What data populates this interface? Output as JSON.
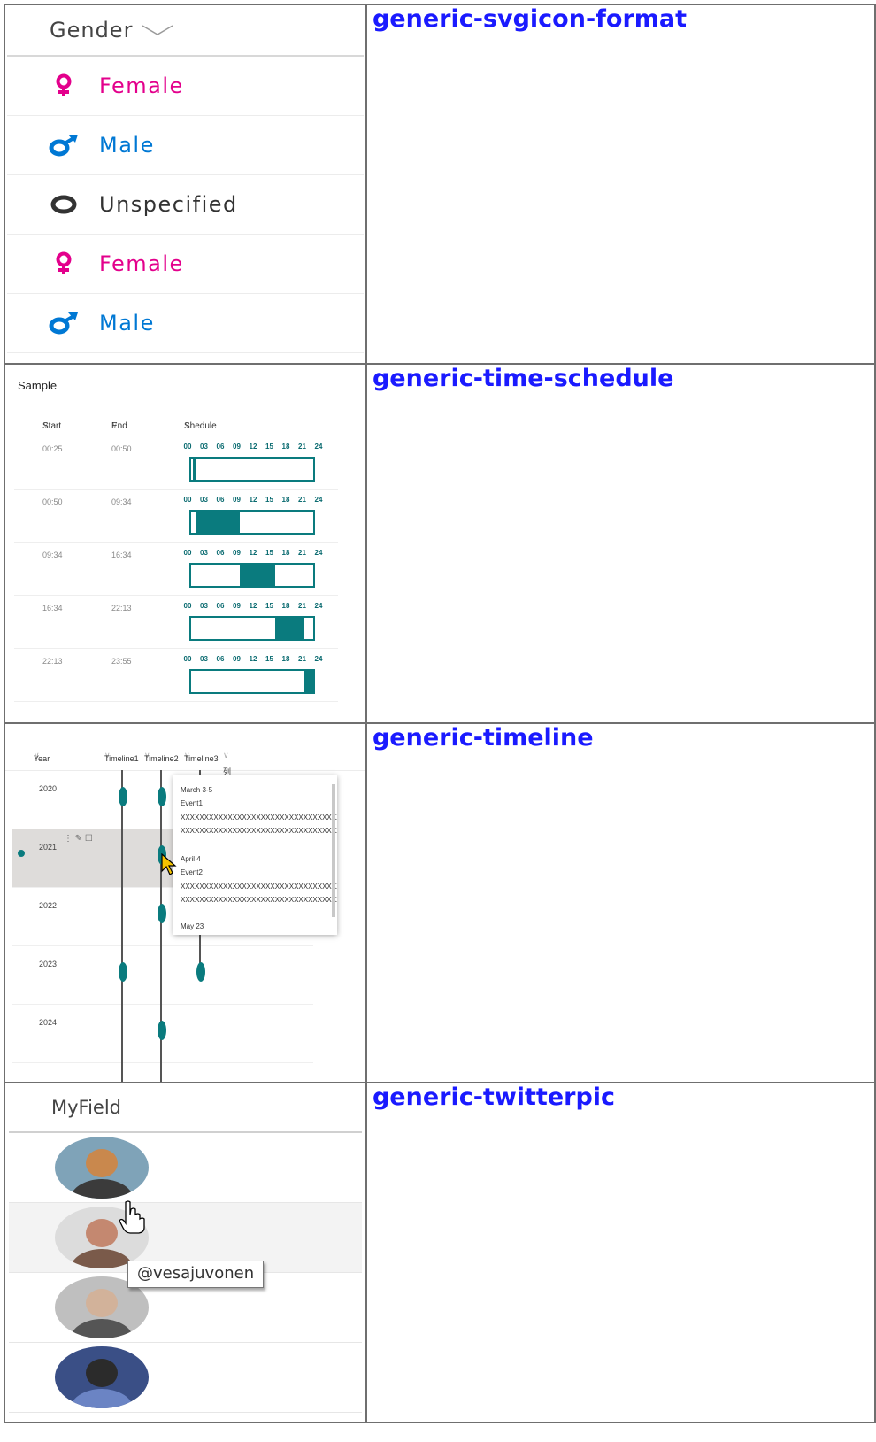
{
  "rows": [
    {
      "link": "generic-svgicon-format"
    },
    {
      "link": "generic-time-schedule"
    },
    {
      "link": "generic-timeline"
    },
    {
      "link": "generic-twitterpic"
    }
  ],
  "gender": {
    "header": "Gender",
    "items": [
      {
        "label": "Female",
        "icon": "female-icon",
        "color": "#e3008c"
      },
      {
        "label": "Male",
        "icon": "male-icon",
        "color": "#0078d4"
      },
      {
        "label": "Unspecified",
        "icon": "circle-icon",
        "color": "#333333"
      },
      {
        "label": "Female",
        "icon": "female-icon",
        "color": "#e3008c"
      },
      {
        "label": "Male",
        "icon": "male-icon",
        "color": "#0078d4"
      }
    ]
  },
  "schedule": {
    "title": "Sample",
    "columns": [
      "Start",
      "End",
      "Shedule"
    ],
    "ticks": [
      "00",
      "03",
      "06",
      "09",
      "12",
      "15",
      "18",
      "21",
      "24"
    ],
    "rows": [
      {
        "start": "00:25",
        "end": "00:50"
      },
      {
        "start": "00:50",
        "end": "09:34"
      },
      {
        "start": "09:34",
        "end": "16:34"
      },
      {
        "start": "16:34",
        "end": "22:13"
      },
      {
        "start": "22:13",
        "end": "23:55"
      }
    ],
    "accent": "#0a7b7e"
  },
  "timeline": {
    "columns": [
      "Year",
      "Timeline1",
      "Timeline2",
      "Timeline3",
      "＋列の追加"
    ],
    "years": [
      "2020",
      "2021",
      "2022",
      "2023",
      "2024"
    ],
    "popup": {
      "lines": [
        "March 3-5",
        "Event1",
        "XXXXXXXXXXXXXXXXXXXXXXXXXXXXXXXXXXXXXXXXXX",
        "XXXXXXXXXXXXXXXXXXXXXXXXXXXXXXXXXXXXXXXXXX",
        "April 4",
        "Event2",
        "XXXXXXXXXXXXXXXXXXXXXXXXXXXXXXXXXXXXXXXXXX",
        "XXXXXXXXXXXXXXXXXXXXXXXXXXXXXXXXXXXXXXXXXX",
        "May 23"
      ]
    }
  },
  "twitter": {
    "header": "MyField",
    "tooltip": "@vesajuvonen",
    "avatars": [
      "avatar-1",
      "avatar-2",
      "avatar-3",
      "avatar-4"
    ]
  }
}
